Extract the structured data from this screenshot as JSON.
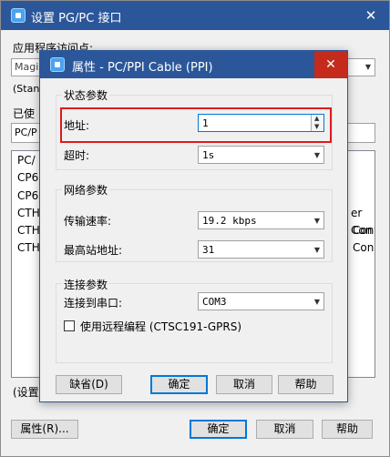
{
  "bg_dialog": {
    "title": "设置 PG/PC 接口",
    "close_icon": "close-icon",
    "access_point_label": "应用程序访问点:",
    "access_point_value": "Magi",
    "standard_text": "(Stan",
    "used_label": "已使",
    "used_value": "PC/P",
    "list_items": [
      "PC/",
      "CP6",
      "CP6",
      "CTH",
      "CTH",
      "CTH"
    ],
    "list_right_items": [
      "er",
      "Con",
      "Contr",
      "Con"
    ],
    "bottom_text": "(设置",
    "properties_button": "属性(R)...",
    "ok_button": "确定",
    "cancel_button": "取消",
    "help_button": "帮助"
  },
  "fg_dialog": {
    "title": "属性 - PC/PPI Cable (PPI)",
    "station_group": "状态参数",
    "address_label": "地址:",
    "address_value": "1",
    "timeout_label": "超时:",
    "timeout_value": "1s",
    "network_group": "网络参数",
    "baud_label": "传输速率:",
    "baud_value": "19.2 kbps",
    "highest_label": "最高站地址:",
    "highest_value": "31",
    "connection_group": "连接参数",
    "port_label": "连接到串口:",
    "port_value": "COM3",
    "remote_label": "使用远程编程 (CTSC191-GPRS)",
    "default_button": "缺省(D)",
    "ok_button": "确定",
    "cancel_button": "取消",
    "help_button": "帮助"
  },
  "colors": {
    "titlebar": "#2b579a",
    "close_red": "#c42b1c",
    "highlight_red": "#e0191b",
    "focus_blue": "#0078d7"
  }
}
